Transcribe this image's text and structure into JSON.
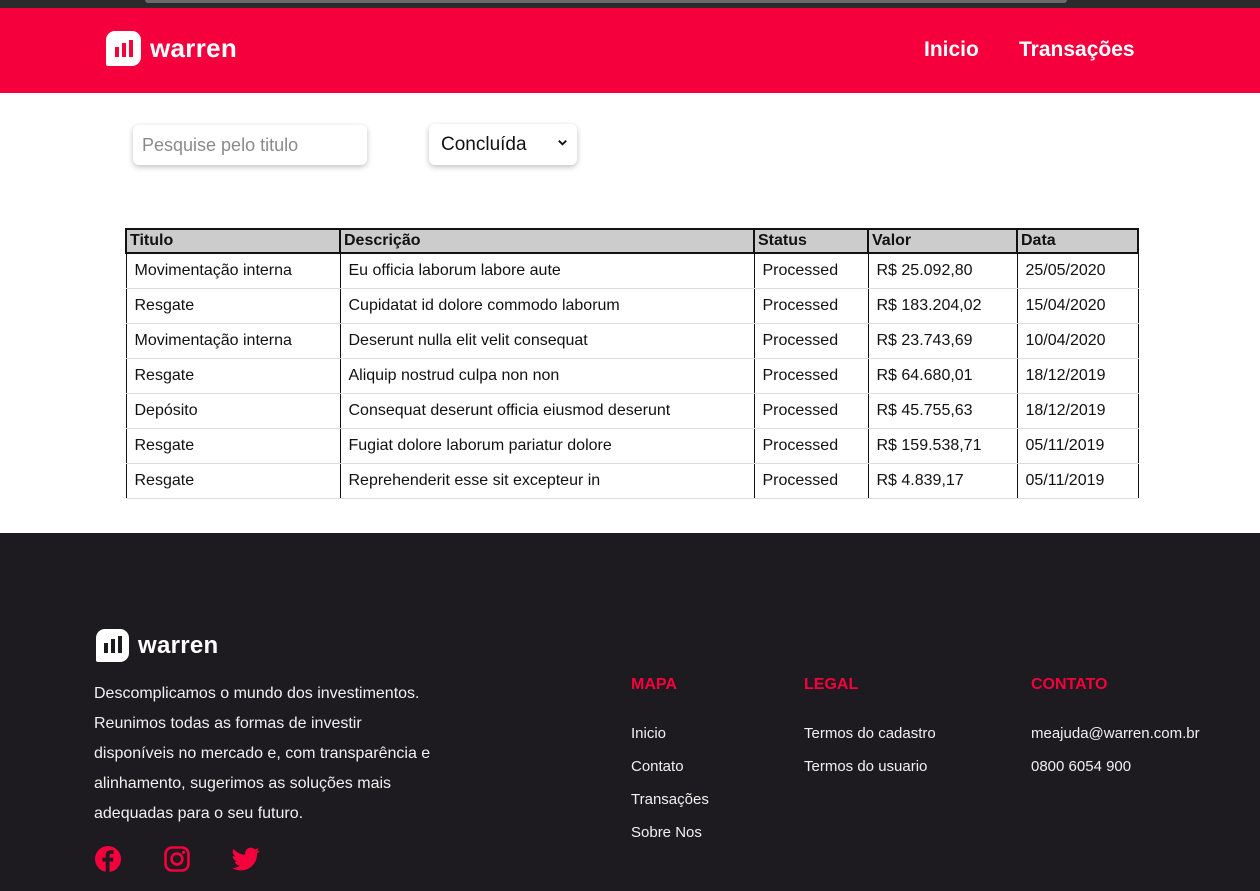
{
  "brand": {
    "name": "warren",
    "accent": "#f5003d",
    "footer_bg": "#1d1b20"
  },
  "nav": {
    "items": [
      {
        "label": "Inicio"
      },
      {
        "label": "Transações"
      }
    ]
  },
  "filters": {
    "search_placeholder": "Pesquise pelo titulo",
    "search_value": "",
    "status_selected": "Concluída"
  },
  "table": {
    "headers": {
      "titulo": "Titulo",
      "descricao": "Descrição",
      "status": "Status",
      "valor": "Valor",
      "data": "Data"
    },
    "rows": [
      {
        "titulo": "Movimentação interna",
        "descricao": "Eu officia laborum labore aute",
        "status": "Processed",
        "valor": "R$ 25.092,80",
        "data": "25/05/2020"
      },
      {
        "titulo": "Resgate",
        "descricao": "Cupidatat id dolore commodo laborum",
        "status": "Processed",
        "valor": "R$ 183.204,02",
        "data": "15/04/2020"
      },
      {
        "titulo": "Movimentação interna",
        "descricao": "Deserunt nulla elit velit consequat",
        "status": "Processed",
        "valor": "R$ 23.743,69",
        "data": "10/04/2020"
      },
      {
        "titulo": "Resgate",
        "descricao": "Aliquip nostrud culpa non non",
        "status": "Processed",
        "valor": "R$ 64.680,01",
        "data": "18/12/2019"
      },
      {
        "titulo": "Depósito",
        "descricao": "Consequat deserunt officia eiusmod deserunt",
        "status": "Processed",
        "valor": "R$ 45.755,63",
        "data": "18/12/2019"
      },
      {
        "titulo": "Resgate",
        "descricao": "Fugiat dolore laborum pariatur dolore",
        "status": "Processed",
        "valor": "R$ 159.538,71",
        "data": "05/11/2019"
      },
      {
        "titulo": "Resgate",
        "descricao": "Reprehenderit esse sit excepteur in",
        "status": "Processed",
        "valor": "R$ 4.839,17",
        "data": "05/11/2019"
      }
    ]
  },
  "footer": {
    "description": "Descomplicamos o mundo dos investimentos. Reunimos todas as formas de investir disponíveis no mercado e, com transparência e alinhamento, sugerimos as soluções mais adequadas para o seu futuro.",
    "socials": [
      {
        "icon": "facebook-icon"
      },
      {
        "icon": "instagram-icon"
      },
      {
        "icon": "twitter-icon"
      }
    ],
    "columns": [
      {
        "title": "MAPA",
        "links": [
          "Inicio",
          "Contato",
          "Transações",
          "Sobre Nos"
        ]
      },
      {
        "title": "LEGAL",
        "links": [
          "Termos do cadastro",
          "Termos do usuario"
        ]
      },
      {
        "title": "CONTATO",
        "links": [
          "meajuda@warren.com.br",
          "0800 6054 900"
        ]
      }
    ]
  }
}
